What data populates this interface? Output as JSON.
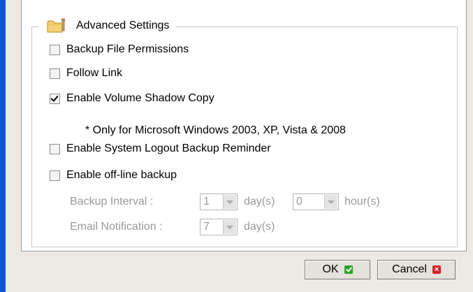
{
  "section": {
    "legend": "Advanced Settings",
    "icon": "folder-settings-icon"
  },
  "options": [
    {
      "label": "Backup File Permissions",
      "checked": false
    },
    {
      "label": "Follow Link",
      "checked": false
    },
    {
      "label": "Enable Volume Shadow Copy",
      "checked": true
    },
    {
      "label": "Enable System Logout Backup Reminder",
      "checked": false
    },
    {
      "label": "Enable off-line backup",
      "checked": false
    }
  ],
  "note": "* Only for Microsoft Windows 2003, XP, Vista & 2008",
  "offline": {
    "interval_label": "Backup Interval :",
    "interval_days": "1",
    "days_unit": "day(s)",
    "interval_hours": "0",
    "hours_unit": "hour(s)",
    "email_label": "Email Notification :",
    "email_days": "7",
    "email_unit": "day(s)"
  },
  "buttons": {
    "ok": "OK",
    "cancel": "Cancel",
    "cancel_icon_glyph": "×"
  },
  "colors": {
    "background_blue": "#0b56d6",
    "dialog": "#eceae3",
    "disabled_text": "#9a9a9a",
    "ok_green": "#2aa52a",
    "cancel_red": "#d8222a"
  }
}
